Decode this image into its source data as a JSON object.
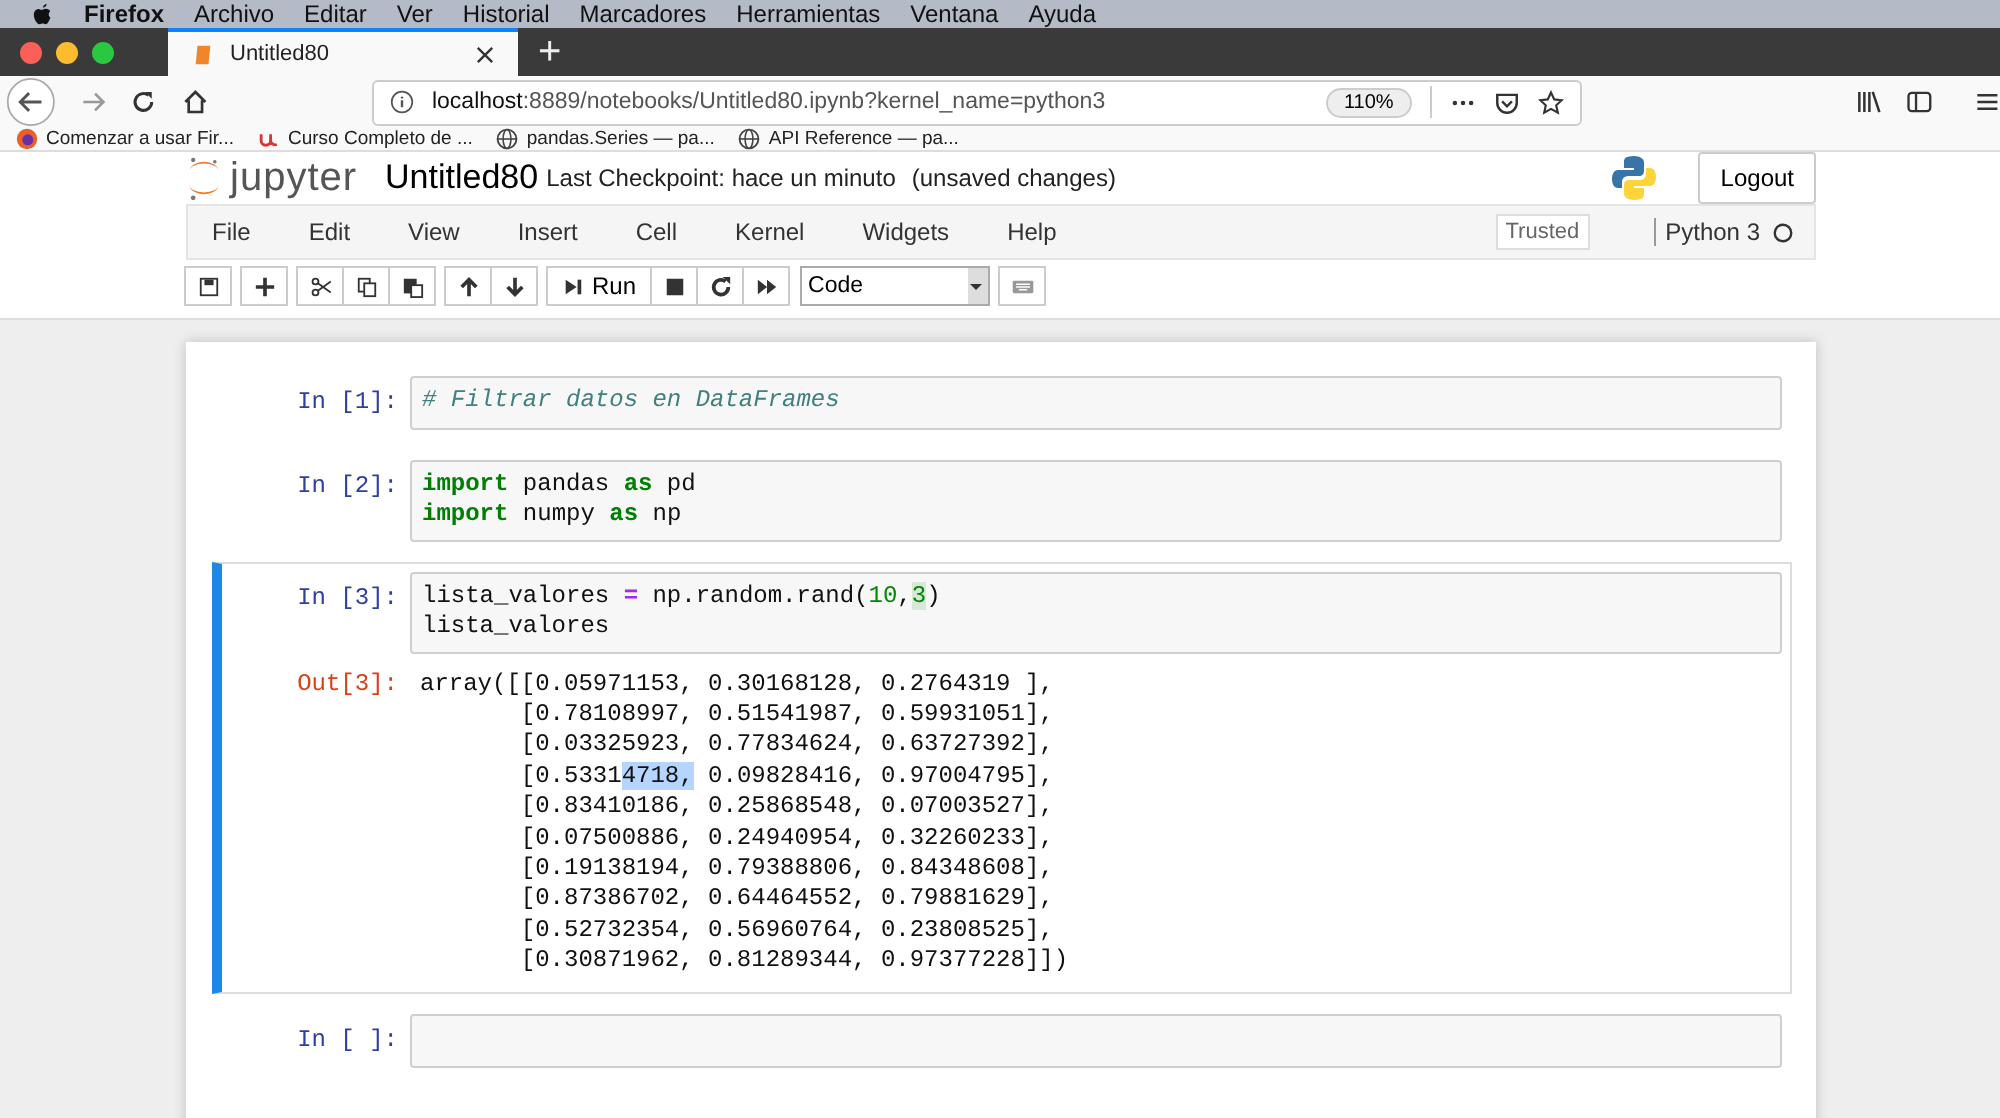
{
  "mac_menu": {
    "app": "Firefox",
    "items": [
      "Archivo",
      "Editar",
      "Ver",
      "Historial",
      "Marcadores",
      "Herramientas",
      "Ventana",
      "Ayuda"
    ]
  },
  "tabs": [
    {
      "title": "Untitled80",
      "selected": true
    }
  ],
  "new_tab": "+",
  "address": {
    "host": "localhost",
    "rest": ":8889/notebooks/Untitled80.ipynb?kernel_name=python3",
    "zoom": "110%"
  },
  "bookmarks": [
    {
      "label": "Comenzar a usar Fir...",
      "kind": "firefox"
    },
    {
      "label": "Curso Completo de ...",
      "kind": "udemy"
    },
    {
      "label": "pandas.Series — pa...",
      "kind": "globe"
    },
    {
      "label": "API Reference — pa...",
      "kind": "globe"
    }
  ],
  "notebook": {
    "logo": "jupyter",
    "name": "Untitled80",
    "checkpoint": "Last Checkpoint: hace un minuto",
    "status": "(unsaved changes)",
    "logout": "Logout"
  },
  "menu": [
    "File",
    "Edit",
    "View",
    "Insert",
    "Cell",
    "Kernel",
    "Widgets",
    "Help"
  ],
  "trusted": "Trusted",
  "kernel": {
    "name": "Python 3",
    "busy": false
  },
  "toolbar": {
    "run": "Run",
    "cell_type": "Code"
  },
  "cells": [
    {
      "prompt": "In [1]:",
      "selected": false,
      "source": [
        [
          {
            "text": "# Filtrar datos en DataFrames",
            "kind": "comment"
          }
        ]
      ]
    },
    {
      "prompt": "In [2]:",
      "selected": false,
      "source": [
        [
          {
            "text": "import",
            "kind": "keyword"
          },
          {
            "text": " pandas ",
            "kind": "plain"
          },
          {
            "text": "as",
            "kind": "keyword"
          },
          {
            "text": " pd",
            "kind": "plain"
          }
        ],
        [
          {
            "text": "import",
            "kind": "keyword"
          },
          {
            "text": " numpy ",
            "kind": "plain"
          },
          {
            "text": "as",
            "kind": "keyword"
          },
          {
            "text": " np",
            "kind": "plain"
          }
        ]
      ]
    },
    {
      "prompt": "In [3]:",
      "selected": true,
      "source": [
        [
          {
            "text": "lista_valores ",
            "kind": "plain"
          },
          {
            "text": "=",
            "kind": "operator"
          },
          {
            "text": " np.random.rand(",
            "kind": "plain"
          },
          {
            "text": "10",
            "kind": "number"
          },
          {
            "text": ",",
            "kind": "plain"
          },
          {
            "text": "3",
            "kind": "bracket"
          },
          {
            "text": ")",
            "kind": "plain"
          }
        ],
        [
          {
            "text": "lista_valores",
            "kind": "plain"
          }
        ]
      ],
      "output": {
        "prompt": "Out[3]:",
        "lines": [
          [
            {
              "text": "array([[0.05971153, 0.30168128, 0.2764319 ],",
              "kind": "plain"
            }
          ],
          [
            {
              "text": "       [0.78108997, 0.51541987, 0.59931051],",
              "kind": "plain"
            }
          ],
          [
            {
              "text": "       [0.03325923, 0.77834624, 0.63727392],",
              "kind": "plain"
            }
          ],
          [
            {
              "text": "       [0.5331",
              "kind": "plain"
            },
            {
              "text": "4718,",
              "kind": "selection"
            },
            {
              "text": " 0.09828416, 0.97004795],",
              "kind": "plain"
            }
          ],
          [
            {
              "text": "       [0.83410186, 0.25868548, 0.07003527],",
              "kind": "plain"
            }
          ],
          [
            {
              "text": "       [0.07500886, 0.24940954, 0.32260233],",
              "kind": "plain"
            }
          ],
          [
            {
              "text": "       [0.19138194, 0.79388806, 0.84348608],",
              "kind": "plain"
            }
          ],
          [
            {
              "text": "       [0.87386702, 0.64464552, 0.79881629],",
              "kind": "plain"
            }
          ],
          [
            {
              "text": "       [0.52732354, 0.56960764, 0.23808525],",
              "kind": "plain"
            }
          ],
          [
            {
              "text": "       [0.30871962, 0.81289344, 0.97377228]])",
              "kind": "plain"
            }
          ]
        ]
      }
    },
    {
      "prompt": "In [ ]:",
      "selected": false
    }
  ]
}
